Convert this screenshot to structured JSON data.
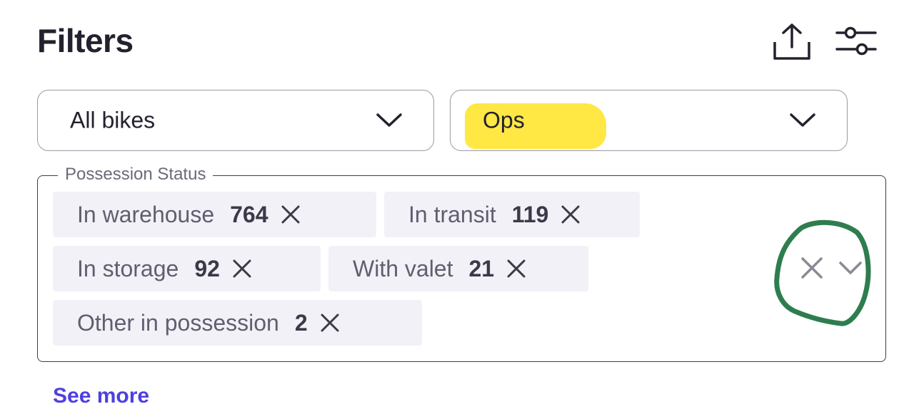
{
  "header": {
    "title": "Filters"
  },
  "icons": {
    "export": "upload-icon",
    "settings": "sliders-icon",
    "chevron": "chevron-down-icon",
    "close": "close-icon"
  },
  "filters": {
    "bike_select": {
      "value": "All bikes"
    },
    "team_select": {
      "value": "Ops",
      "highlight_color": "#ffe63a"
    }
  },
  "possession_status": {
    "legend": "Possession Status",
    "chips": [
      {
        "label": "In warehouse",
        "count": "764"
      },
      {
        "label": "In transit",
        "count": "119"
      },
      {
        "label": "In storage",
        "count": "92"
      },
      {
        "label": "With valet",
        "count": "21"
      },
      {
        "label": "Other in possession",
        "count": "2"
      }
    ]
  },
  "annotation": {
    "circle_color": "#2e7d4f"
  },
  "footer": {
    "see_more": "See more"
  },
  "colors": {
    "accent": "#4d40e0",
    "chip_bg": "#f2f1f8",
    "text": "#22222e"
  }
}
